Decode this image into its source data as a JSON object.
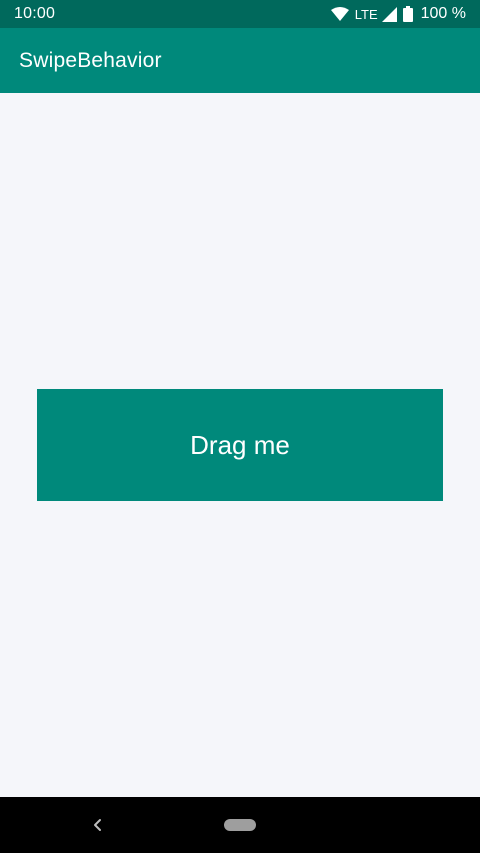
{
  "status_bar": {
    "time": "10:00",
    "network": "LTE",
    "battery": "100 %",
    "icons": [
      "wifi-icon",
      "signal-icon",
      "battery-icon"
    ]
  },
  "app_bar": {
    "title": "SwipeBehavior"
  },
  "content": {
    "drag_box_label": "Drag me"
  },
  "nav_bar": {
    "icons": [
      "back-icon",
      "home-pill-icon"
    ]
  },
  "colors": {
    "status_bar": "#00695c",
    "primary": "#00897b",
    "background": "#f5f6fa",
    "nav_bar": "#000000"
  }
}
